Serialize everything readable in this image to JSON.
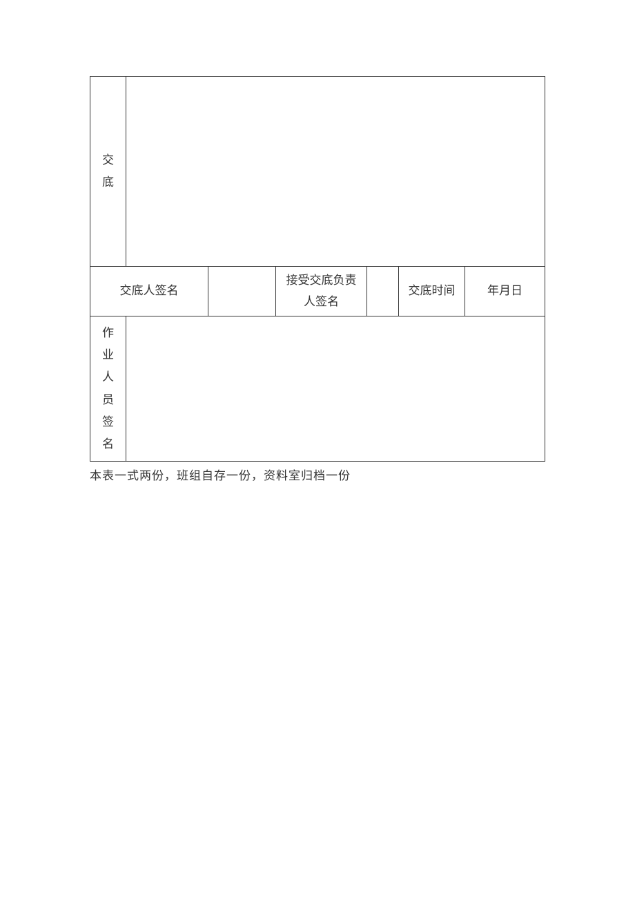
{
  "row1": {
    "label_char1": "交",
    "label_char2": "底"
  },
  "row2": {
    "label1": "交底人签名",
    "label2_line1": "接受交底负责",
    "label2_line2": "人签名",
    "label3": "交底时间",
    "date": "年月日"
  },
  "row3": {
    "label_char1": "作",
    "label_char2": "业",
    "label_char3": "人",
    "label_char4": "员",
    "label_char5": "签",
    "label_char6": "名"
  },
  "footer": "本表一式两份，班组自存一份，资料室归档一份"
}
